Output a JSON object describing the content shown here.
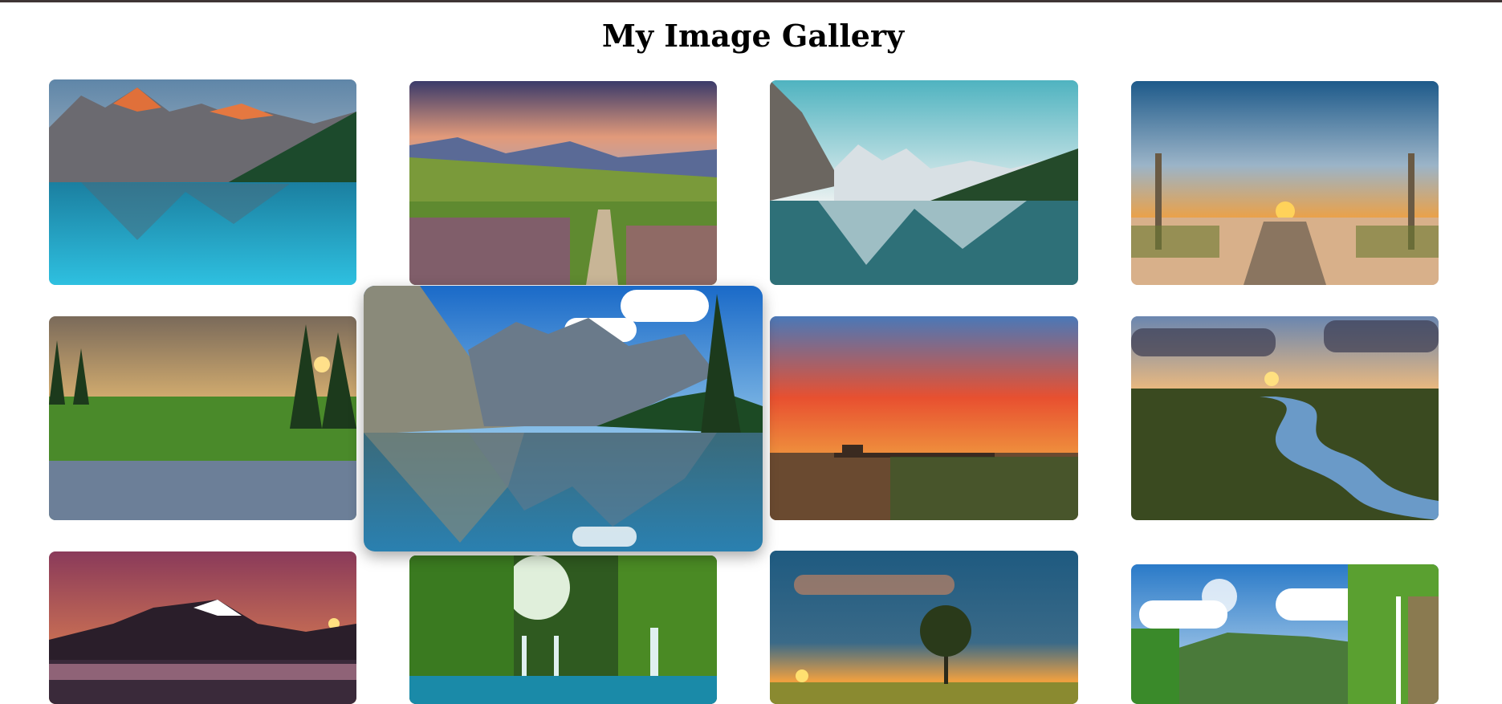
{
  "page": {
    "title": "My Image Gallery"
  },
  "colors": {
    "top_bar": "#3f3535",
    "background": "#ffffff",
    "title_text": "#000000"
  },
  "gallery": {
    "images": [
      {
        "subject": "mountain-lake-sunrise-icon",
        "state": "normal"
      },
      {
        "subject": "flower-meadow-path-icon",
        "state": "normal"
      },
      {
        "subject": "glacier-lake-reflection-icon",
        "state": "normal"
      },
      {
        "subject": "boardwalk-beach-sunset-icon",
        "state": "normal"
      },
      {
        "subject": "wildflower-forest-sunset-icon",
        "state": "normal"
      },
      {
        "subject": "alpine-lake-reflection-icon",
        "state": "hovered-enlarged"
      },
      {
        "subject": "lake-pier-orange-sunset-icon",
        "state": "normal"
      },
      {
        "subject": "river-marsh-sunset-icon",
        "state": "normal"
      },
      {
        "subject": "snow-peak-twilight-icon",
        "state": "normal"
      },
      {
        "subject": "forest-waterfalls-icon",
        "state": "normal"
      },
      {
        "subject": "lone-tree-sunset-icon",
        "state": "normal"
      },
      {
        "subject": "jungle-waterfall-valley-icon",
        "state": "normal"
      }
    ]
  }
}
